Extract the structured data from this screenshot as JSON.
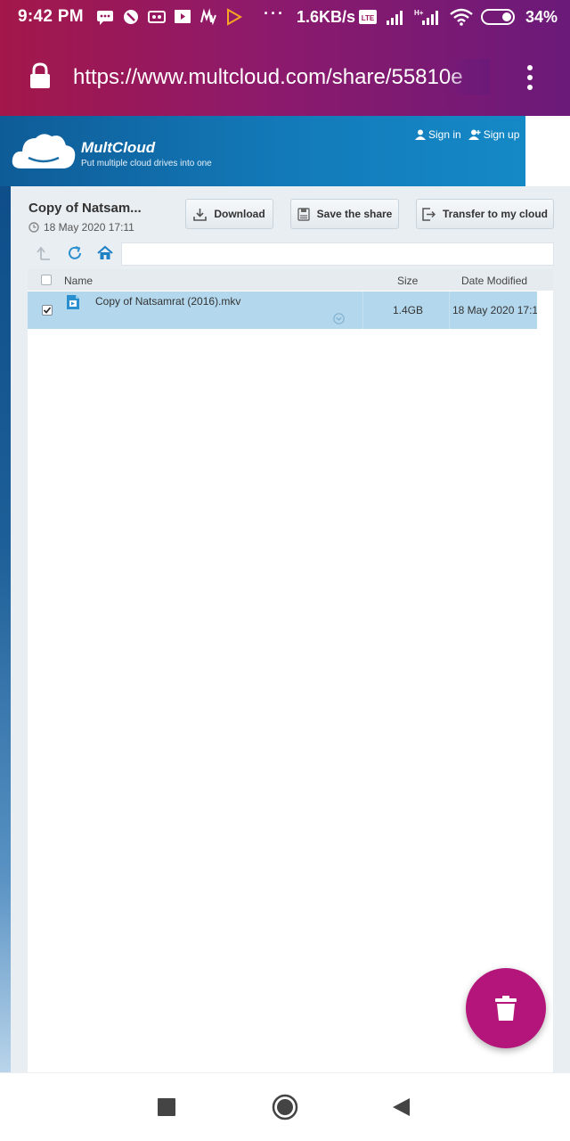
{
  "status_bar": {
    "time": "9:42 PM",
    "dots": "···",
    "speed": "1.6KB/s",
    "battery": "34%"
  },
  "browser": {
    "url": "https://www.multcloud.com/share/55810e"
  },
  "header": {
    "brand": "MultCloud",
    "tagline": "Put multiple cloud drives into one",
    "sign_in": "Sign in",
    "sign_up": "Sign up"
  },
  "share": {
    "title": "Copy of Natsam...",
    "date": "18 May 2020 17:11"
  },
  "toolbar": {
    "download": "Download",
    "save": "Save the share",
    "transfer": "Transfer to my cloud"
  },
  "table": {
    "columns": {
      "name": "Name",
      "size": "Size",
      "date": "Date Modified"
    },
    "rows": [
      {
        "name": "Copy of Natsamrat (2016).mkv",
        "size": "1.4GB",
        "date": "18 May 2020 17:11",
        "checked": true
      }
    ]
  },
  "colors": {
    "accent_fab": "#b3157a",
    "row_selected": "#b3d7ec",
    "banner": "#137ab9"
  }
}
